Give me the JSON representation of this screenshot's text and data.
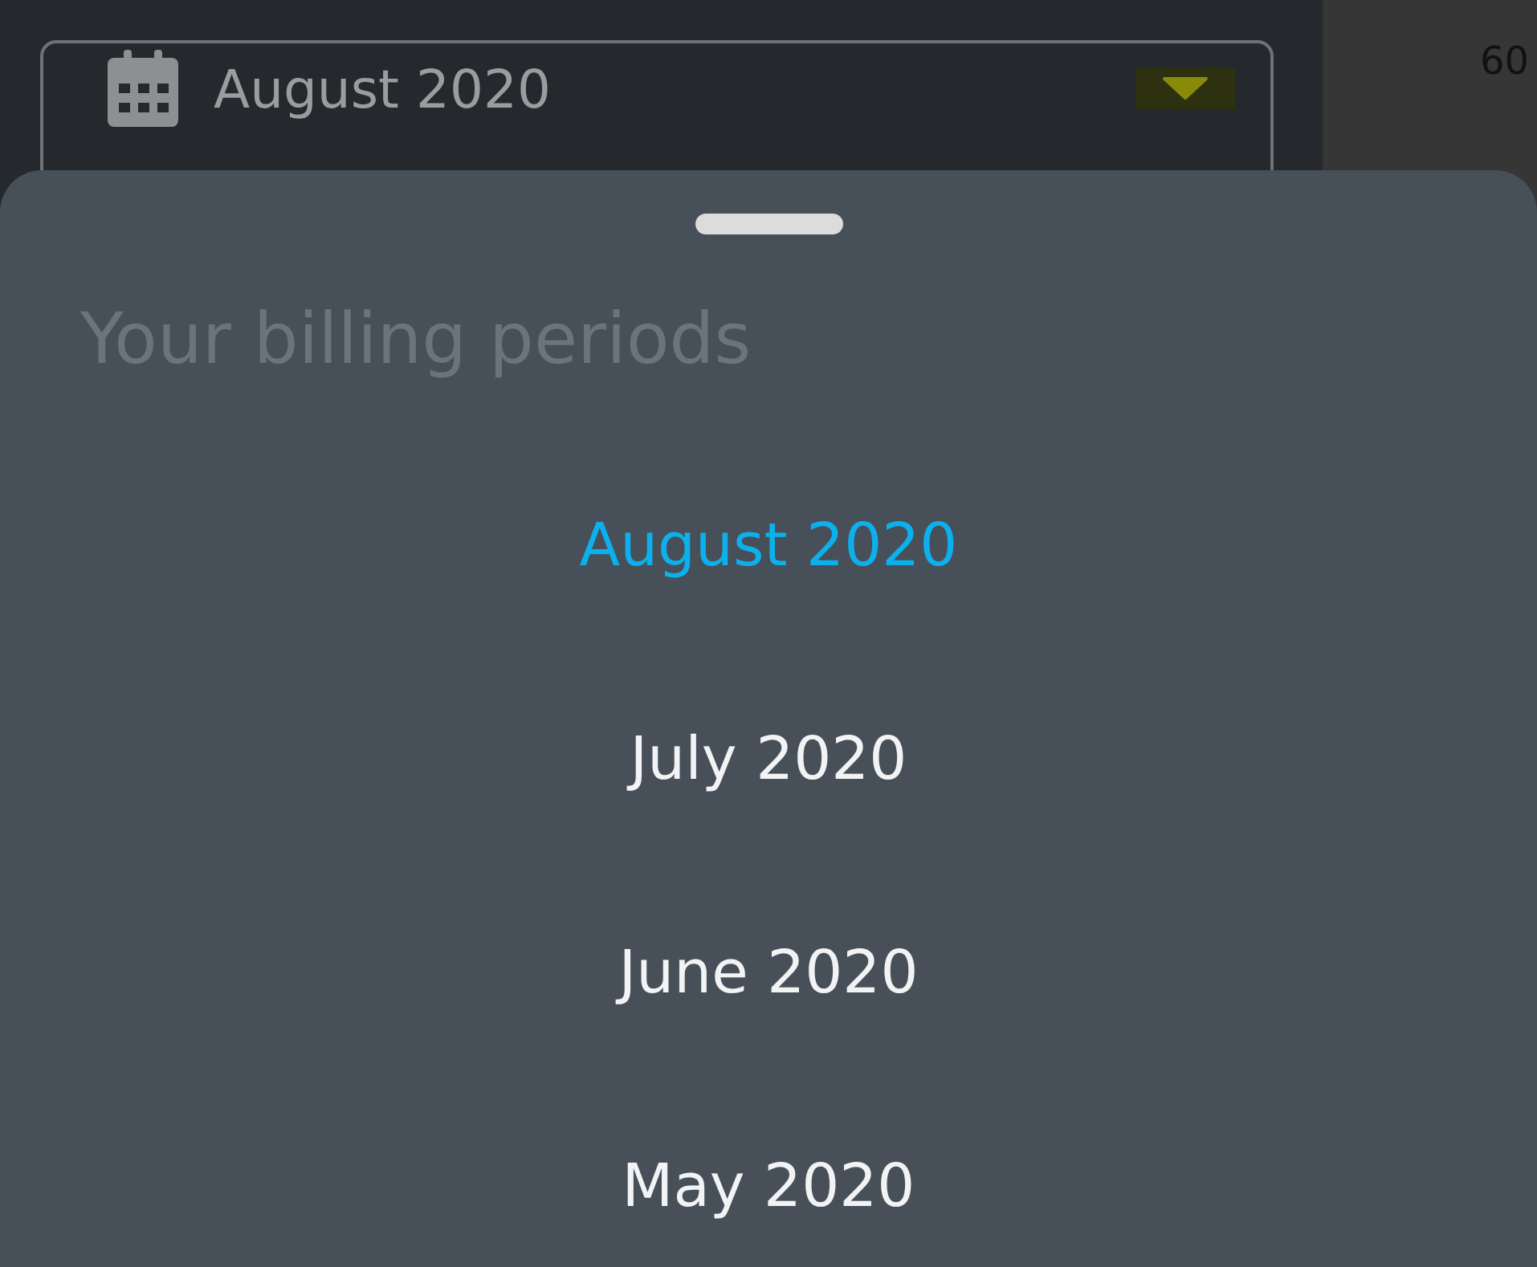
{
  "period_field": {
    "value": "August 2020"
  },
  "side_panel": {
    "text": "60"
  },
  "sheet": {
    "title": "Your billing periods",
    "periods": [
      {
        "label": "August 2020",
        "selected": true
      },
      {
        "label": "July 2020",
        "selected": false
      },
      {
        "label": "June 2020",
        "selected": false
      },
      {
        "label": "May 2020",
        "selected": false
      }
    ]
  }
}
